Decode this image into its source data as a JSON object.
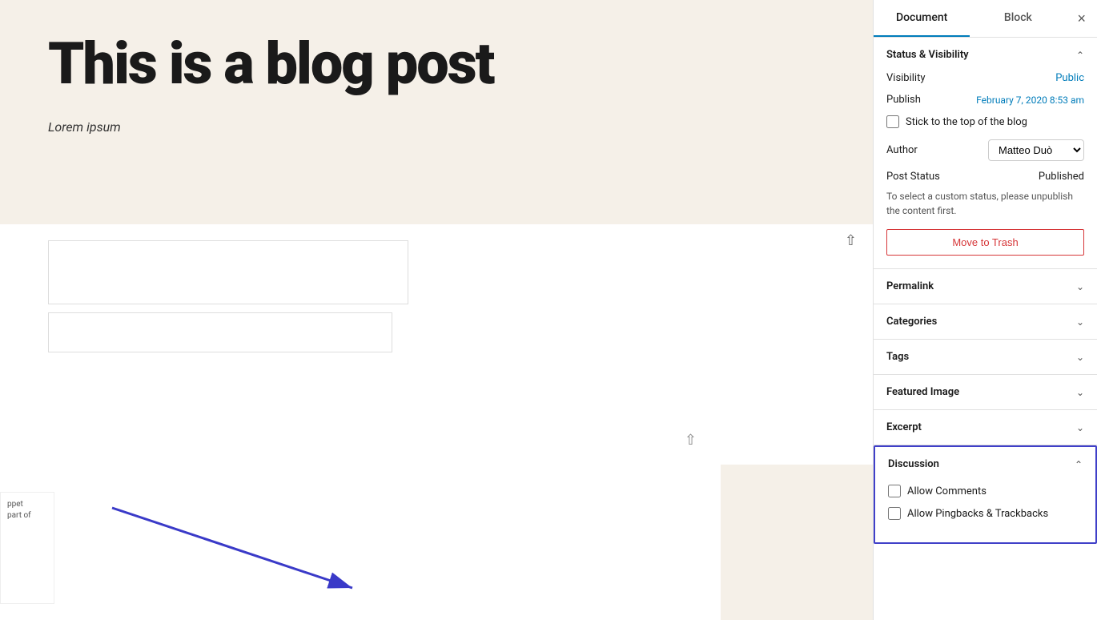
{
  "sidebar": {
    "tabs": [
      {
        "id": "document",
        "label": "Document",
        "active": true
      },
      {
        "id": "block",
        "label": "Block",
        "active": false
      }
    ],
    "close_label": "×",
    "sections": {
      "status_visibility": {
        "title": "Status & Visibility",
        "expanded": true,
        "visibility_label": "Visibility",
        "visibility_value": "Public",
        "publish_label": "Publish",
        "publish_value": "February 7, 2020 8:53 am",
        "stick_to_top_label": "Stick to the top of the blog",
        "stick_to_top_checked": false,
        "author_label": "Author",
        "author_value": "Matteo Duò",
        "post_status_label": "Post Status",
        "post_status_value": "Published",
        "status_info": "To select a custom status, please unpublish the content first.",
        "move_to_trash_label": "Move to Trash"
      },
      "permalink": {
        "title": "Permalink",
        "expanded": false
      },
      "categories": {
        "title": "Categories",
        "expanded": false
      },
      "tags": {
        "title": "Tags",
        "expanded": false
      },
      "featured_image": {
        "title": "Featured Image",
        "expanded": false
      },
      "excerpt": {
        "title": "Excerpt",
        "expanded": false
      },
      "discussion": {
        "title": "Discussion",
        "expanded": true,
        "allow_comments_label": "Allow Comments",
        "allow_comments_checked": false,
        "allow_pingbacks_label": "Allow Pingbacks & Trackbacks",
        "allow_pingbacks_checked": false
      }
    }
  },
  "main": {
    "blog_title": "This is a blog post",
    "lorem_text": "Lorem ipsum"
  }
}
